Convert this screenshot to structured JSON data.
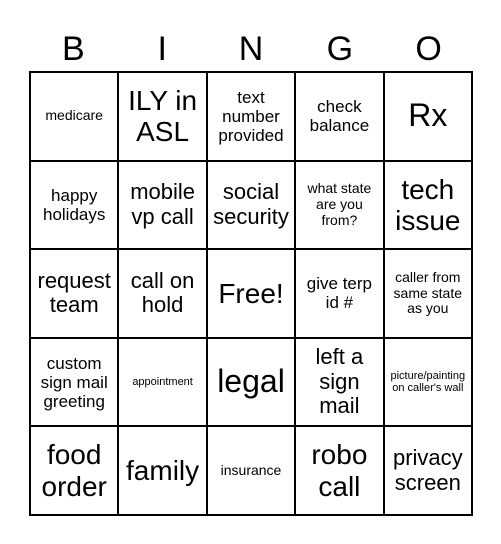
{
  "title_letters": [
    "B",
    "I",
    "N",
    "G",
    "O"
  ],
  "cells": [
    {
      "text": "medicare",
      "size": "s-sm"
    },
    {
      "text": "ILY in ASL",
      "size": "s-xl"
    },
    {
      "text": "text number provided",
      "size": "s-md"
    },
    {
      "text": "check balance",
      "size": "s-md"
    },
    {
      "text": "Rx",
      "size": "s-xxl"
    },
    {
      "text": "happy holidays",
      "size": "s-md"
    },
    {
      "text": "mobile vp call",
      "size": "s-lg"
    },
    {
      "text": "social security",
      "size": "s-lg"
    },
    {
      "text": "what state are you from?",
      "size": "s-sm"
    },
    {
      "text": "tech issue",
      "size": "s-xl"
    },
    {
      "text": "request team",
      "size": "s-lg"
    },
    {
      "text": "call on hold",
      "size": "s-lg"
    },
    {
      "text": "Free!",
      "size": "s-xl"
    },
    {
      "text": "give terp id #",
      "size": "s-md"
    },
    {
      "text": "caller from same state as you",
      "size": "s-sm"
    },
    {
      "text": "custom sign mail greeting",
      "size": "s-md"
    },
    {
      "text": "appointment",
      "size": "s-xs"
    },
    {
      "text": "legal",
      "size": "s-xxl"
    },
    {
      "text": "left a sign mail",
      "size": "s-lg"
    },
    {
      "text": "picture/painting on caller's wall",
      "size": "s-xs"
    },
    {
      "text": "food order",
      "size": "s-xl"
    },
    {
      "text": "family",
      "size": "s-xl"
    },
    {
      "text": "insurance",
      "size": "s-sm"
    },
    {
      "text": "robo call",
      "size": "s-xl"
    },
    {
      "text": "privacy screen",
      "size": "s-lg"
    }
  ]
}
